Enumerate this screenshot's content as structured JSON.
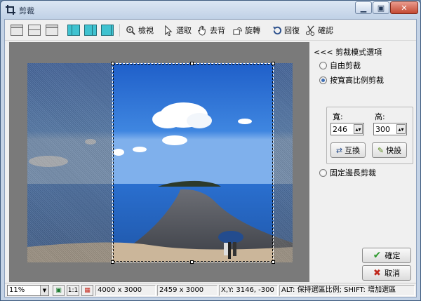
{
  "window": {
    "title": "剪裁",
    "minimize_icon": "minimize-icon",
    "maximize_icon": "maximize-icon",
    "close_icon": "close-icon"
  },
  "toolbar": {
    "layout_buttons": [
      "layout-1-icon",
      "layout-2-icon",
      "layout-3-icon",
      "layout-4-icon",
      "layout-5-icon",
      "layout-6-icon"
    ],
    "view": "檢視",
    "select": "選取",
    "remove_bg": "去背",
    "rotate": "旋轉",
    "restore": "回復",
    "confirm": "確認"
  },
  "panel": {
    "title": "<<< 剪裁模式選項",
    "mode_free": "自由剪裁",
    "mode_ratio": "按寬高比例剪裁",
    "mode_fixed": "固定邊長剪裁",
    "selected_mode": "mode_ratio",
    "width_label": "寬:",
    "height_label": "高:",
    "width_value": "246",
    "height_value": "300",
    "swap": "互換",
    "quick": "快設"
  },
  "actions": {
    "ok": "確定",
    "cancel": "取消"
  },
  "status": {
    "zoom": "11%",
    "one_to_one": "1:1",
    "image_size": "4000 x 3000",
    "crop_size": "2459 x 3000",
    "coords": "X,Y: 3146, -300",
    "hint": "ALT: 保持選區比例; SHIFT: 增加選區"
  },
  "colors": {
    "accent": "#3fc2d0",
    "ok_check": "#2e9a2e",
    "cancel_x": "#c0281c"
  }
}
